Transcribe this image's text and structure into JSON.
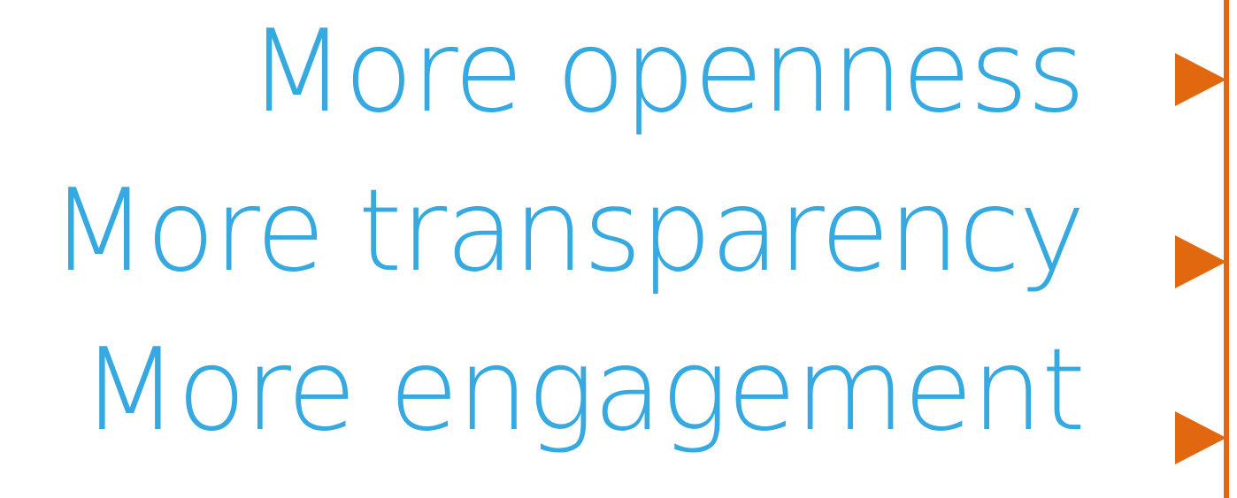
{
  "lines": [
    {
      "text": "More openness"
    },
    {
      "text": "More transparency"
    },
    {
      "text": "More engagement"
    }
  ],
  "colors": {
    "text": "#36a9e1",
    "accent": "#e2680f",
    "background": "#ffffff"
  },
  "icons": {
    "marker": "triangle-right-icon"
  }
}
